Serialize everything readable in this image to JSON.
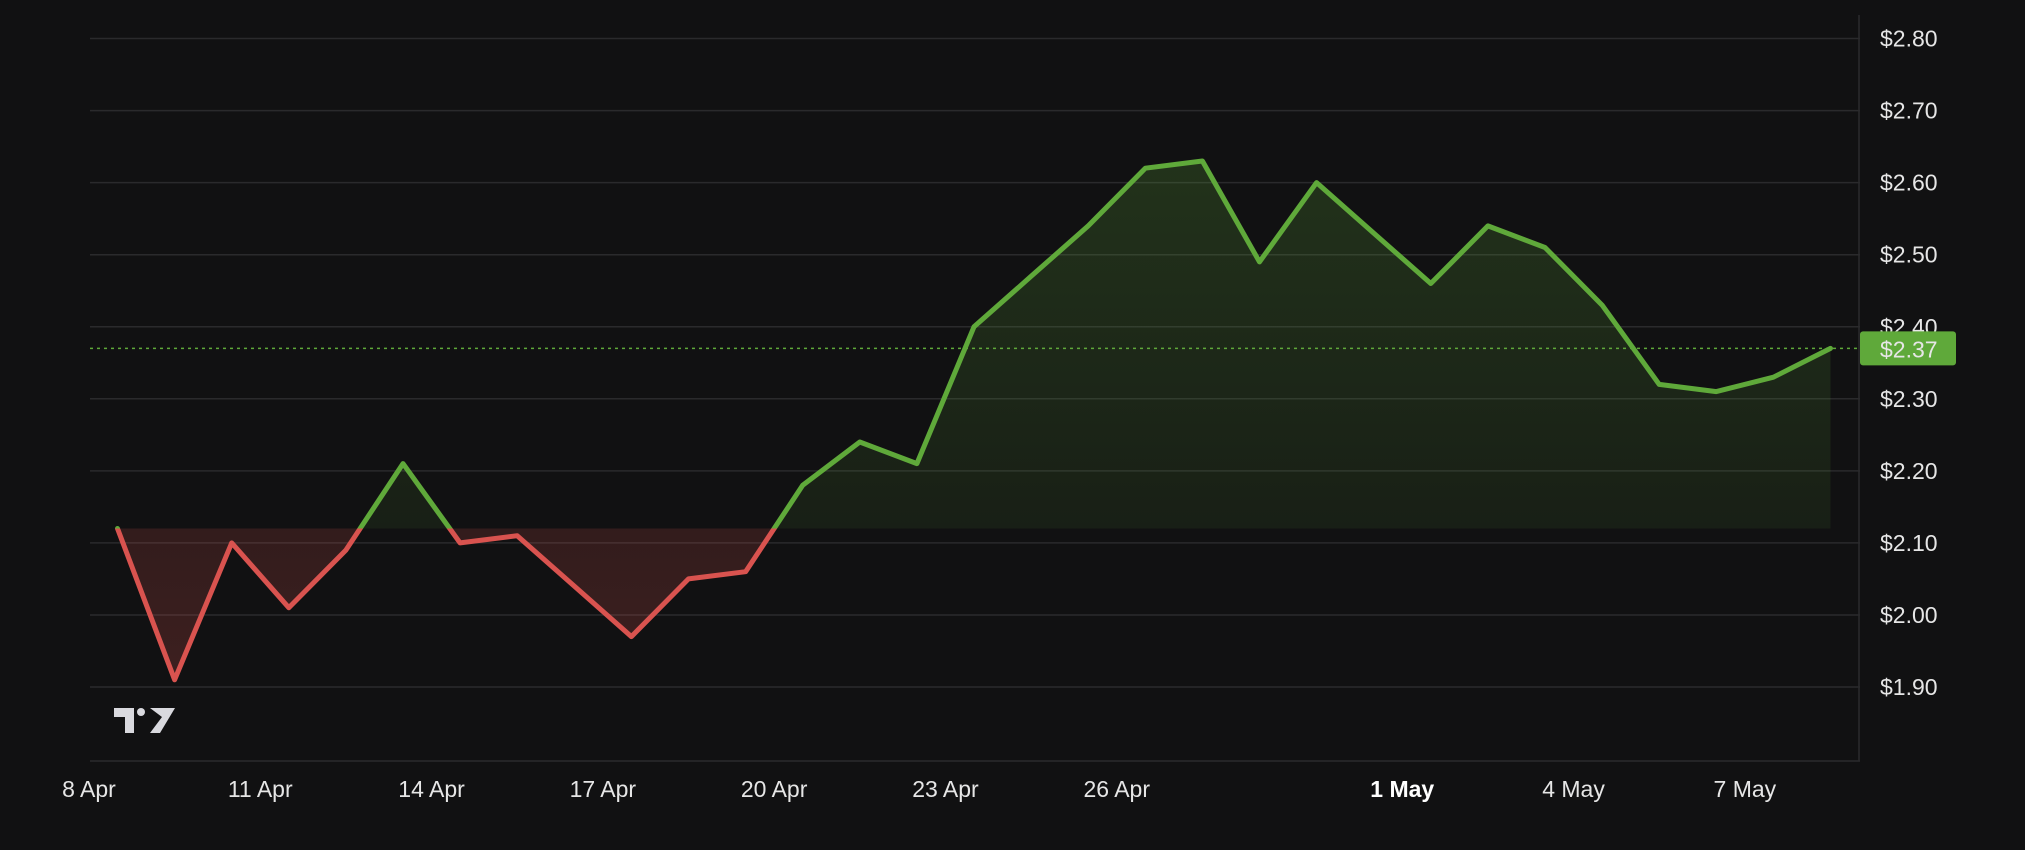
{
  "chart_data": {
    "type": "area",
    "baseline": 2.12,
    "current_price": 2.37,
    "current_price_label": "$2.37",
    "y_ticks": [
      1.9,
      2.0,
      2.1,
      2.2,
      2.3,
      2.4,
      2.5,
      2.6,
      2.7,
      2.8
    ],
    "y_tick_labels": [
      "$1.90",
      "$2.00",
      "$2.10",
      "$2.20",
      "$2.30",
      "$2.40",
      "$2.50",
      "$2.60",
      "$2.70",
      "$2.80"
    ],
    "ylim": [
      1.8,
      2.82
    ],
    "x_ticks": [
      {
        "day": 8,
        "label": "8 Apr",
        "bold": false
      },
      {
        "day": 11,
        "label": "11 Apr",
        "bold": false
      },
      {
        "day": 14,
        "label": "14 Apr",
        "bold": false
      },
      {
        "day": 17,
        "label": "17 Apr",
        "bold": false
      },
      {
        "day": 20,
        "label": "20 Apr",
        "bold": false
      },
      {
        "day": 23,
        "label": "23 Apr",
        "bold": false
      },
      {
        "day": 26,
        "label": "26 Apr",
        "bold": false
      },
      {
        "day": 31,
        "label": "1 May",
        "bold": true
      },
      {
        "day": 34,
        "label": "4 May",
        "bold": false
      },
      {
        "day": 37,
        "label": "7 May",
        "bold": false
      }
    ],
    "x": [
      8.5,
      9.5,
      10.5,
      11.5,
      12.5,
      13.5,
      14.5,
      15.5,
      16.5,
      17.5,
      18.5,
      19.5,
      20.5,
      21.5,
      22.5,
      23.5,
      24.5,
      25.5,
      26.5,
      27.5,
      28.5,
      29.5,
      30.5,
      31.5,
      32.5,
      33.5,
      34.5,
      35.5,
      36.5,
      37.5,
      38.5
    ],
    "y": [
      2.12,
      1.91,
      2.1,
      2.01,
      2.09,
      2.21,
      2.1,
      2.11,
      2.04,
      1.97,
      2.05,
      2.06,
      2.18,
      2.24,
      2.21,
      2.4,
      2.47,
      2.54,
      2.62,
      2.63,
      2.49,
      2.6,
      2.53,
      2.46,
      2.54,
      2.51,
      2.43,
      2.32,
      2.31,
      2.33,
      2.37
    ],
    "colors": {
      "up": "#5fa93a",
      "down": "#d9534f",
      "grid": "#2a2a2c",
      "background": "#111112"
    },
    "logo": "tradingview-logo"
  }
}
